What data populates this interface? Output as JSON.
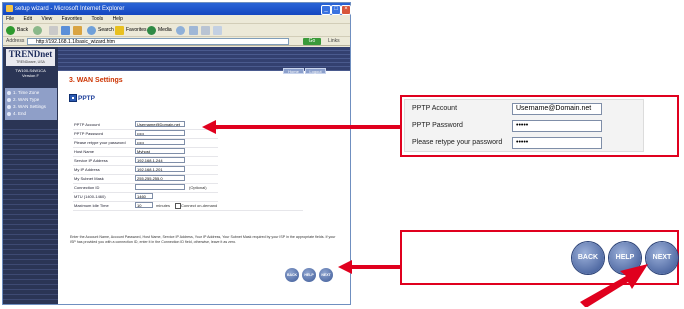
{
  "browser": {
    "title": "setup wizard - Microsoft Internet Explorer",
    "menu": [
      "File",
      "Edit",
      "View",
      "Favorites",
      "Tools",
      "Help"
    ],
    "toolbar": {
      "back": "Back",
      "search": "Search",
      "favorites": "Favorites",
      "media": "Media"
    },
    "address_label": "Address",
    "address": "http://192.168.1.1/basic_wizard.htm",
    "go": "Go",
    "links": "Links"
  },
  "sidebar": {
    "brand": "TRENDnet",
    "tagline": "TRENDware, USA",
    "model_line1": "TW100-S4W1CA",
    "model_line2": "Version F",
    "steps": [
      {
        "label": "1. Time Zone"
      },
      {
        "label": "2. WAN Type"
      },
      {
        "label": "3. WAN Settings"
      },
      {
        "label": "4. End"
      }
    ]
  },
  "header": {
    "home": "Home",
    "logout": "Logout"
  },
  "content": {
    "heading": "3. WAN Settings",
    "section": "PPTP",
    "fields": [
      {
        "label": "PPTP Account",
        "value": "Username@Domain.net"
      },
      {
        "label": "PPTP Password",
        "value": "•••••"
      },
      {
        "label": "Please retype your password",
        "value": "•••••"
      },
      {
        "label": "Host Name",
        "value": "Myhost"
      },
      {
        "label": "Service IP Address",
        "value": "192.168.1.244"
      },
      {
        "label": "My IP Address",
        "value": "192.168.1.201"
      },
      {
        "label": "My Subnet Mask",
        "value": "255.255.255.0"
      },
      {
        "label": "Connection ID",
        "value": "",
        "note": "(Optional)"
      },
      {
        "label": "MTU (1400-1460)",
        "value": "1460"
      },
      {
        "label": "Maximum Idle Time",
        "value": "10",
        "note": "minutes",
        "checkbox_label": "Connect on-demand"
      }
    ],
    "instructions": "Enter the Account Name, Account Password, Host Name, Service IP Address, Your IP Address, Your Subnet Mask required by your ISP in the appropriate fields. If your ISP has provided you with a connection ID, enter it in the Connection ID field, otherwise, leave it as zero.",
    "buttons": {
      "back": "BACK",
      "help": "HELP",
      "next": "NEXT"
    }
  },
  "zoom_fields": [
    {
      "label": "PPTP Account",
      "value": "Username@Domain.net"
    },
    {
      "label": "PPTP Password",
      "value": "•••••"
    },
    {
      "label": "Please retype your password",
      "value": "•••••"
    }
  ],
  "zoom_buttons": {
    "back": "BACK",
    "help": "HELP",
    "next": "NEXT"
  },
  "colors": {
    "accent": "#e0001e",
    "sidebar": "#2b3555",
    "heading": "#cc3300"
  }
}
